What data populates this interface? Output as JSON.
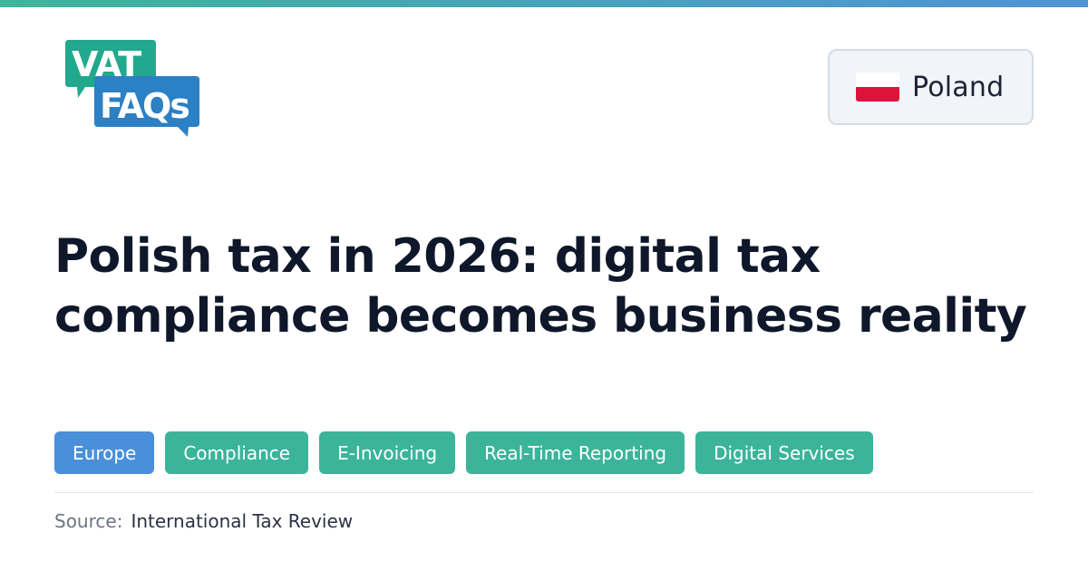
{
  "logo": {
    "line1": "VAT",
    "line2": "FAQs",
    "color_top": "#22a88c",
    "color_bottom": "#2c80c4"
  },
  "country": {
    "name": "Poland",
    "flag_colors": [
      "#ffffff",
      "#dc143c"
    ]
  },
  "headline": "Polish tax in 2026: digital tax compliance becomes business reality",
  "tags": [
    {
      "label": "Europe",
      "color": "#4a8fd8"
    },
    {
      "label": "Compliance",
      "color": "#3bb49a"
    },
    {
      "label": "E-Invoicing",
      "color": "#3bb49a"
    },
    {
      "label": "Real-Time Reporting",
      "color": "#3bb49a"
    },
    {
      "label": "Digital Services",
      "color": "#3bb49a"
    }
  ],
  "source": {
    "label": "Source:",
    "value": "International Tax Review"
  },
  "accent_gradient": [
    "#3fb59a",
    "#4f93d8"
  ]
}
